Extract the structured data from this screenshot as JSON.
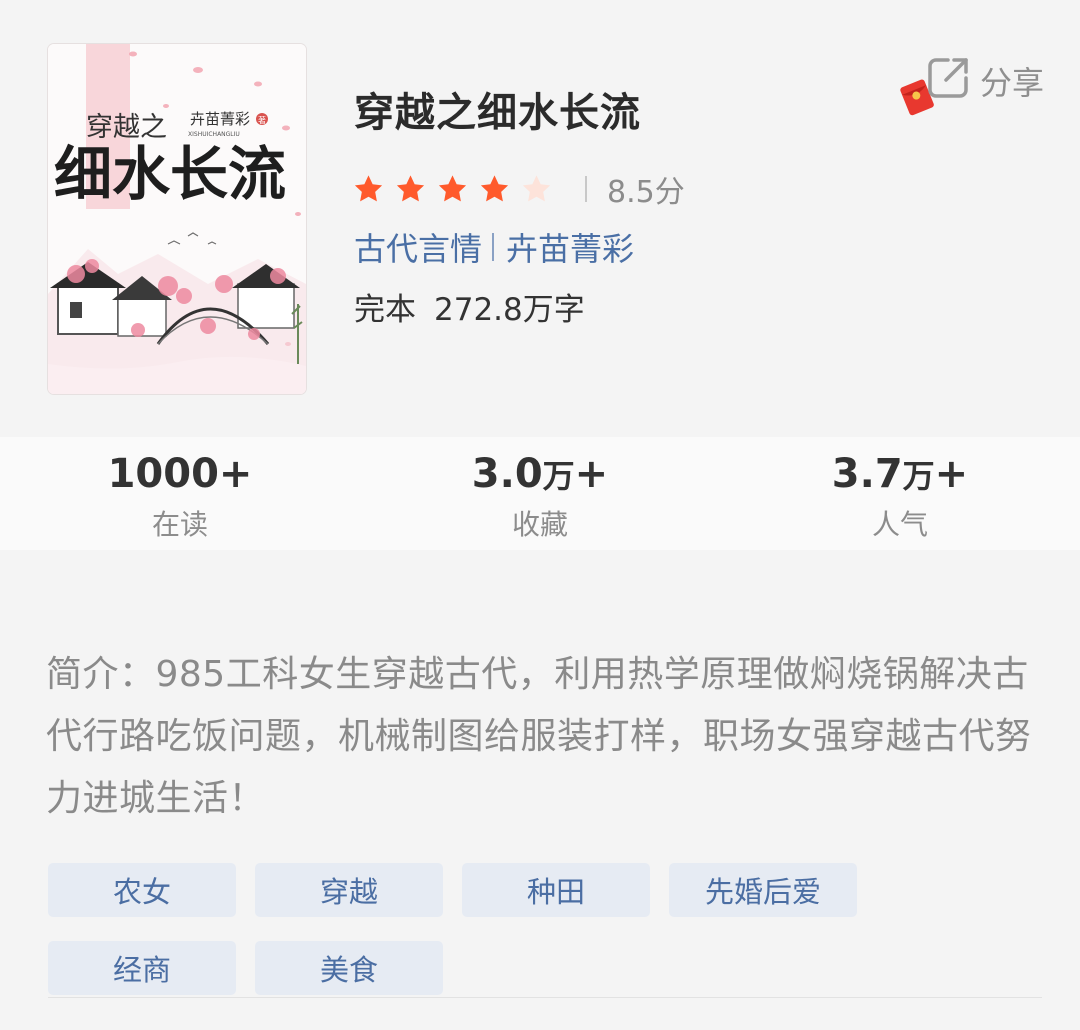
{
  "book": {
    "title": "穿越之细水长流",
    "rating": {
      "stars_filled": 4,
      "stars_total": 5,
      "score": "8.5分"
    },
    "category": "古代言情",
    "author": "卉苗菁彩",
    "status": "完本",
    "word_count": "272.8万字",
    "cover": {
      "prefix": "穿越之",
      "main_title": "细水长流",
      "author": "卉苗菁彩",
      "seal": "著",
      "pinyin": "XISHUICHANGLIU"
    }
  },
  "share": {
    "label": "分享"
  },
  "stats": [
    {
      "value": "1000+",
      "unit": "",
      "suffix": "",
      "label": "在读"
    },
    {
      "value": "3.0",
      "unit": "万",
      "suffix": "+",
      "label": "收藏"
    },
    {
      "value": "3.7",
      "unit": "万",
      "suffix": "+",
      "label": "人气"
    }
  ],
  "synopsis": "简介：985工科女生穿越古代，利用热学原理做焖烧锅解决古代行路吃饭问题，机械制图给服装打样，职场女强穿越古代努力进城生活！",
  "tags": [
    "农女",
    "穿越",
    "种田",
    "先婚后爱",
    "经商",
    "美食"
  ],
  "colors": {
    "star_filled": "#ff5a2c",
    "star_empty": "#fde3da",
    "link": "#4a6fa5",
    "tag_bg": "#e6ebf3",
    "tag_text": "#4b6ea3"
  }
}
